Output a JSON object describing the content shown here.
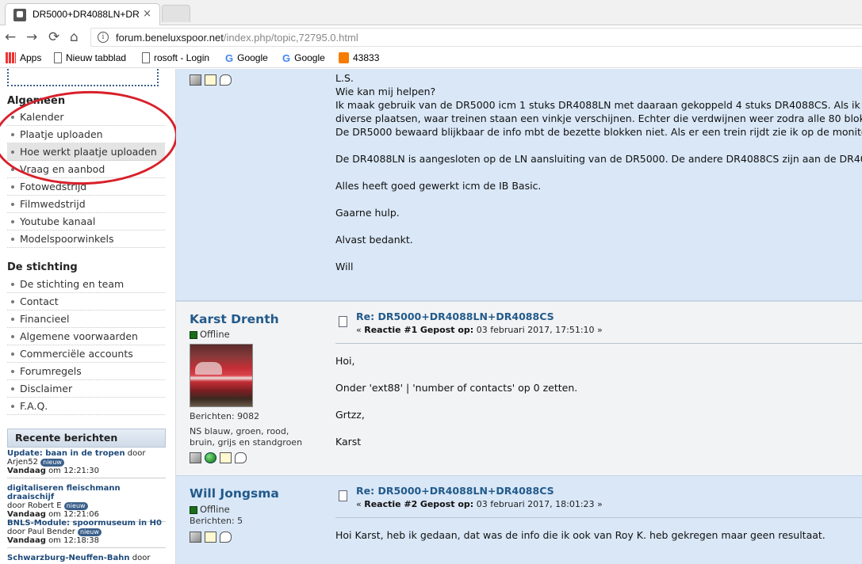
{
  "browser": {
    "tab_title": "DR5000+DR4088LN+DR",
    "tab_close": "×",
    "url_domain": "forum.beneluxspoor.net",
    "url_path": "/index.php/topic,72795.0.html",
    "url_info": "i",
    "nav_back": "←",
    "nav_forward": "→",
    "nav_reload": "⟳",
    "nav_home": "⌂",
    "bookmarks": [
      "Apps",
      "Nieuw tabblad",
      "rosoft - Login",
      "Google",
      "Google",
      "43833"
    ]
  },
  "sidebar": {
    "algemeen_heading": "Algemeen",
    "algemeen_items": [
      "Kalender",
      "Plaatje uploaden",
      "Hoe werkt plaatje uploaden",
      "Vraag en aanbod",
      "Fotowedstrijd",
      "Filmwedstrijd",
      "Youtube kanaal",
      "Modelspoorwinkels"
    ],
    "stichting_heading": "De stichting",
    "stichting_items": [
      "De stichting en team",
      "Contact",
      "Financieel",
      "Algemene voorwaarden",
      "Commerciële accounts",
      "Forumregels",
      "Disclaimer",
      "F.A.Q."
    ],
    "recent_heading": "Recente berichten",
    "recent": [
      {
        "title": "Update: baan in de tropen",
        "by": "door",
        "author": "Arjen52",
        "badge": "nieuw",
        "day": "Vandaag",
        "time": "om 12:21:30"
      },
      {
        "title": "digitaliseren fleischmann draaischijf",
        "by": "door",
        "author": "Robert E",
        "badge": "nieuw",
        "day": "Vandaag",
        "time": "om 12:21:06"
      },
      {
        "title": "BNLS-Module: spoormuseum in H0",
        "by": "door",
        "author": "Paul Bender",
        "badge": "nieuw",
        "day": "Vandaag",
        "time": "om 12:18:38"
      },
      {
        "title": "Schwarzburg-Neuffen-Bahn",
        "by": "door",
        "author": "",
        "badge": "",
        "day": "",
        "time": ""
      }
    ]
  },
  "posts": [
    {
      "lines": [
        "L.S.",
        "Wie kan mij helpen?",
        "Ik maak gebruik van de DR5000 icm 1 stuks DR4088LN met daaraan gekoppeld 4 stuks DR4088CS. Als ik",
        "diverse plaatsen, waar treinen staan een vinkje verschijnen. Echter die verdwijnen weer zodra alle 80 blokke",
        "De DR5000 bewaard blijkbaar de info mbt de bezette blokken niet. Als er een trein rijdt zie ik op de monitor",
        "De DR4088LN is aangesloten op de LN aansluiting van de DR5000. De andere DR4088CS zijn aan de DR40",
        "Alles heeft goed gewerkt icm de IB Basic.",
        "Gaarne hulp.",
        "Alvast bedankt.",
        "Will"
      ]
    },
    {
      "author": "Karst Drenth",
      "status": "Offline",
      "posts_count": "Berichten: 9082",
      "signature": [
        "NS blauw, groen, rood,",
        "bruin, grijs en standgroen"
      ],
      "subject": "Re: DR5000+DR4088LN+DR4088CS",
      "reply_prefix": "« ",
      "reply_no": "Reactie #1",
      "posted_label": "Gepost op:",
      "posted_date": "03 februari 2017, 17:51:10 »",
      "lines": [
        "Hoi,",
        "Onder 'ext88' | 'number of contacts' op 0 zetten.",
        "Grtzz,",
        "Karst"
      ]
    },
    {
      "author": "Will Jongsma",
      "status": "Offline",
      "posts_count": "Berichten: 5",
      "subject": "Re: DR5000+DR4088LN+DR4088CS",
      "reply_prefix": "« ",
      "reply_no": "Reactie #2",
      "posted_label": "Gepost op:",
      "posted_date": "03 februari 2017, 18:01:23 »",
      "lines": [
        "Hoi Karst, heb ik gedaan, dat was de info die ik ook van Roy K. heb gekregen maar geen resultaat."
      ]
    }
  ]
}
